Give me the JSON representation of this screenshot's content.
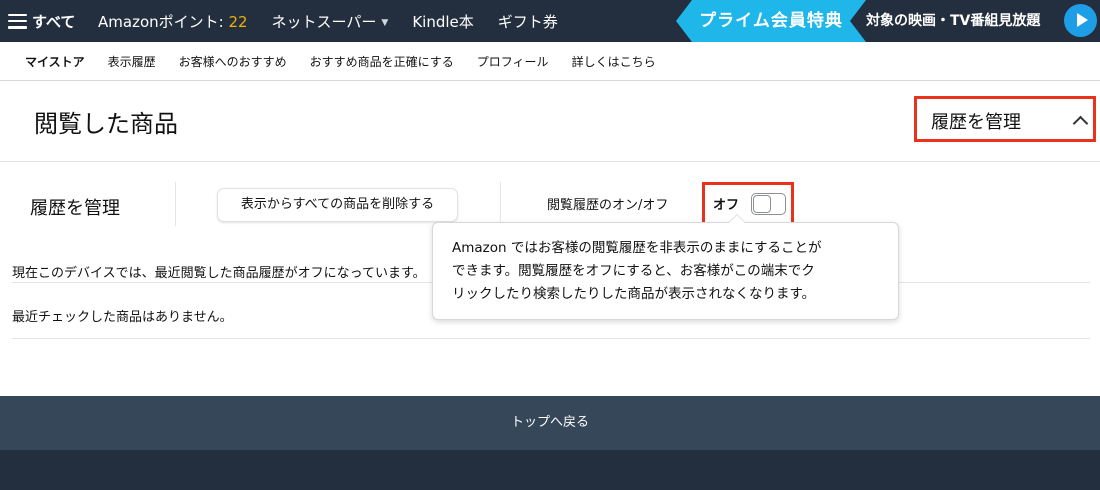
{
  "topnav": {
    "menu_label": "すべて",
    "points_label": "Amazonポイント: ",
    "points_value": "22",
    "items": [
      "ネットスーパー",
      "Kindle本",
      "ギフト券"
    ],
    "prime_banner": "プライム会員特典",
    "prime_sub": "対象の映画・TV番組見放題",
    "colors": {
      "nav_bg": "#232f3e",
      "points": "#f0b100",
      "prime_banner": "#1fb6ea",
      "play": "#1e9ee6"
    },
    "icons": {
      "menu": "hamburger-icon",
      "dropdown": "caret-down-icon",
      "play": "play-icon"
    }
  },
  "subnav": {
    "items": [
      "マイストア",
      "表示履歴",
      "お客様へのおすすめ",
      "おすすめ商品を正確にする",
      "プロフィール",
      "詳しくはこちら"
    ]
  },
  "page": {
    "title": "閲覧した商品",
    "manage_toggle_label": "履歴を管理",
    "manage_toggle_icon": "chevron-up-icon",
    "highlight_color": "#e8321c"
  },
  "manage": {
    "heading": "履歴を管理",
    "delete_button": "表示からすべての商品を削除する",
    "onoff_label": "閲覧履歴のオン/オフ",
    "toggle_state": "オフ",
    "toggle_on": false
  },
  "info": {
    "line1": "現在このデバイスでは、最近閲覧した商品履歴がオフになっています。",
    "line2": "最近チェックした商品はありません。"
  },
  "popover": {
    "line1": "Amazon ではお客様の閲覧履歴を非表示のままにすることが",
    "line2": "できます。閲覧履歴をオフにすると、お客様がこの端末でク",
    "line3": "リックしたり検索したりした商品が表示されなくなります。"
  },
  "footer": {
    "back_to_top": "トップへ戻る",
    "colors": {
      "back_to_top_bg": "#37475a",
      "footer_bg": "#232f3e"
    }
  }
}
